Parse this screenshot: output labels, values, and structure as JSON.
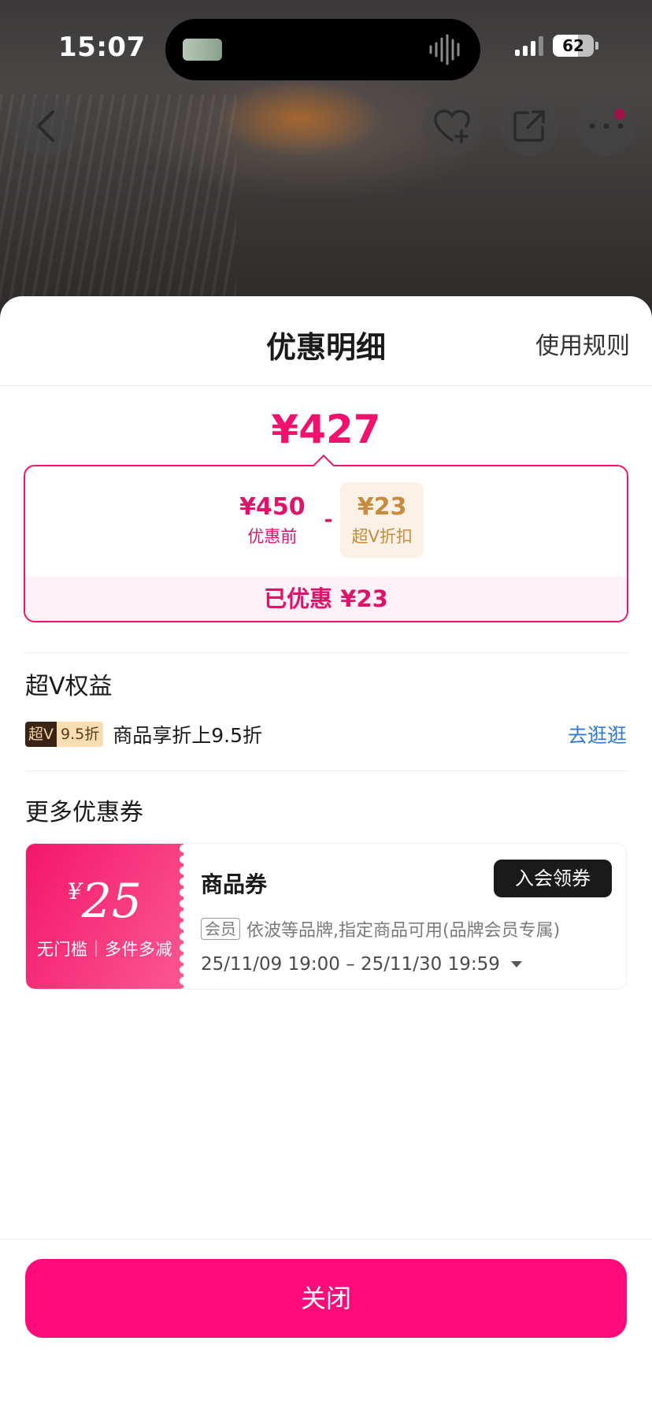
{
  "status_bar": {
    "time": "15:07",
    "battery": "62"
  },
  "nav": {
    "icons": [
      "back-icon",
      "favorite-add-icon",
      "share-icon",
      "more-icon"
    ]
  },
  "sheet": {
    "title": "优惠明细",
    "rules_link": "使用规则",
    "total_price": "¥427",
    "breakdown": {
      "original_amount": "¥450",
      "original_label": "优惠前",
      "operator": "-",
      "discount_amount": "¥23",
      "discount_label": "超V折扣",
      "saved_text": "已优惠 ¥23"
    },
    "vip_section": {
      "title": "超V权益",
      "tag_main": "超V",
      "tag_discount": "9.5折",
      "description": "商品享折上9.5折",
      "link": "去逛逛"
    },
    "coupon_section": {
      "title": "更多优惠券",
      "coupon": {
        "currency": "¥",
        "amount": "25",
        "condition": "无门槛｜多件多减",
        "name": "商品券",
        "action": "入会领券",
        "member_tag": "会员",
        "scope": "依波等品牌,指定商品可用(品牌会员专属)",
        "validity": "25/11/09 19:00 – 25/11/30 19:59"
      }
    },
    "close_button": "关闭"
  },
  "colors": {
    "accent": "#f0126c",
    "close_button": "#ff0a7a",
    "vip_gold": "#c88b3e",
    "link_blue": "#2f7bd8"
  }
}
